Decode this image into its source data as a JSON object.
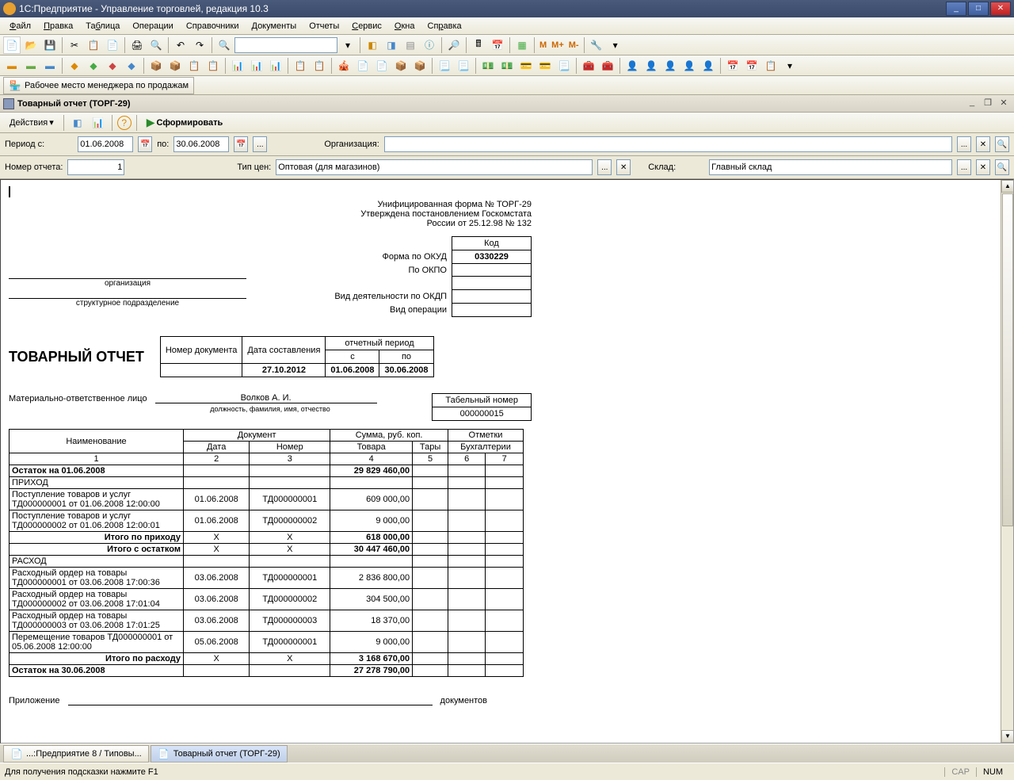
{
  "titlebar": {
    "text": "1С:Предприятие - Управление торговлей, редакция 10.3"
  },
  "menu": [
    "Файл",
    "Правка",
    "Таблица",
    "Операции",
    "Справочники",
    "Документы",
    "Отчеты",
    "Сервис",
    "Окна",
    "Справка"
  ],
  "menu_underline": [
    "Ф",
    "П",
    "Т",
    "",
    "",
    "Д",
    "",
    "С",
    "О",
    "С"
  ],
  "workplace": {
    "label": "Рабочее место менеджера по продажам"
  },
  "doc": {
    "title": "Товарный отчет (ТОРГ-29)"
  },
  "actions": {
    "btn": "Действия",
    "form": "Сформировать"
  },
  "params": {
    "period_label": "Период с:",
    "date_from": "01.06.2008",
    "to_label": "по:",
    "date_to": "30.06.2008",
    "org_label": "Организация:",
    "org_value": "",
    "report_num_label": "Номер отчета:",
    "report_num": "1",
    "price_type_label": "Тип цен:",
    "price_type": "Оптовая (для магазинов)",
    "warehouse_label": "Склад:",
    "warehouse": "Главный склад"
  },
  "report": {
    "form_line1": "Унифицированная форма № ТОРГ-29",
    "form_line2": "Утверждена постановлением Госкомстата",
    "form_line3": "России от  25.12.98  № 132",
    "code_header": "Код",
    "okud_label": "Форма по ОКУД",
    "okud": "0330229",
    "okpo_label": "По ОКПО",
    "okpo": "",
    "org_sub": "организация",
    "struct_sub": "структурное подразделение",
    "okdp_label": "Вид деятельности по ОКДП",
    "operation_label": "Вид операции",
    "title": "ТОВАРНЫЙ  ОТЧЕТ",
    "docinfo": {
      "h_num": "Номер документа",
      "h_date": "Дата составления",
      "h_period": "отчетный период",
      "h_from": "с",
      "h_to": "по",
      "num": "",
      "date": "27.10.2012",
      "from": "01.06.2008",
      "to": "30.06.2008"
    },
    "resp_label": "Материально-ответственное лицо",
    "resp_name": "Волков А. И.",
    "resp_sub": "должность, фамилия, имя, отчество",
    "tabnum_label": "Табельный номер",
    "tabnum": "000000015",
    "table": {
      "h_name": "Наименование",
      "h_doc": "Документ",
      "h_sum": "Сумма, руб. коп.",
      "h_marks": "Отметки",
      "h_date": "Дата",
      "h_num": "Номер",
      "h_goods": "Товара",
      "h_tara": "Тары",
      "h_buh": "Бухгалтерии",
      "cols": [
        "1",
        "2",
        "3",
        "4",
        "5",
        "6",
        "7"
      ],
      "rows": [
        {
          "name": "Остаток на 01.06.2008",
          "date": "",
          "num": "",
          "goods": "29 829 460,00",
          "bold": true
        },
        {
          "name": "ПРИХОД",
          "date": "",
          "num": "",
          "goods": ""
        },
        {
          "name": "Поступление товаров и услуг ТД000000001 от 01.06.2008 12:00:00",
          "date": "01.06.2008",
          "num": "ТД000000001",
          "goods": "609 000,00"
        },
        {
          "name": "Поступление товаров и услуг ТД000000002 от 01.06.2008 12:00:01",
          "date": "01.06.2008",
          "num": "ТД000000002",
          "goods": "9 000,00"
        },
        {
          "name": "Итого по приходу",
          "date": "Х",
          "num": "Х",
          "goods": "618 000,00",
          "bold": true,
          "right_name": true
        },
        {
          "name": "Итого с остатком",
          "date": "Х",
          "num": "Х",
          "goods": "30 447 460,00",
          "bold": true,
          "right_name": true,
          "dashed": true
        },
        {
          "name": "РАСХОД",
          "date": "",
          "num": "",
          "goods": ""
        },
        {
          "name": "Расходный ордер на товары ТД000000001 от 03.06.2008 17:00:36",
          "date": "03.06.2008",
          "num": "ТД000000001",
          "goods": "2 836 800,00"
        },
        {
          "name": "Расходный ордер на товары ТД000000002 от 03.06.2008 17:01:04",
          "date": "03.06.2008",
          "num": "ТД000000002",
          "goods": "304 500,00"
        },
        {
          "name": "Расходный ордер на товары ТД000000003 от 03.06.2008 17:01:25",
          "date": "03.06.2008",
          "num": "ТД000000003",
          "goods": "18 370,00"
        },
        {
          "name": "Перемещение товаров ТД000000001 от 05.06.2008 12:00:00",
          "date": "05.06.2008",
          "num": "ТД000000001",
          "goods": "9 000,00"
        },
        {
          "name": "Итого по расходу",
          "date": "Х",
          "num": "Х",
          "goods": "3 168 670,00",
          "bold": true,
          "right_name": true
        },
        {
          "name": "Остаток на 30.06.2008",
          "date": "",
          "num": "",
          "goods": "27 278 790,00",
          "bold": true
        }
      ]
    },
    "attach_label": "Приложение",
    "attach_docs": "документов"
  },
  "taskbar": [
    {
      "label": "...:Предприятие 8 / Типовы...",
      "active": false
    },
    {
      "label": "Товарный отчет (ТОРГ-29)",
      "active": true
    }
  ],
  "status": {
    "hint": "Для получения подсказки нажмите F1",
    "cap": "CAP",
    "num": "NUM"
  }
}
